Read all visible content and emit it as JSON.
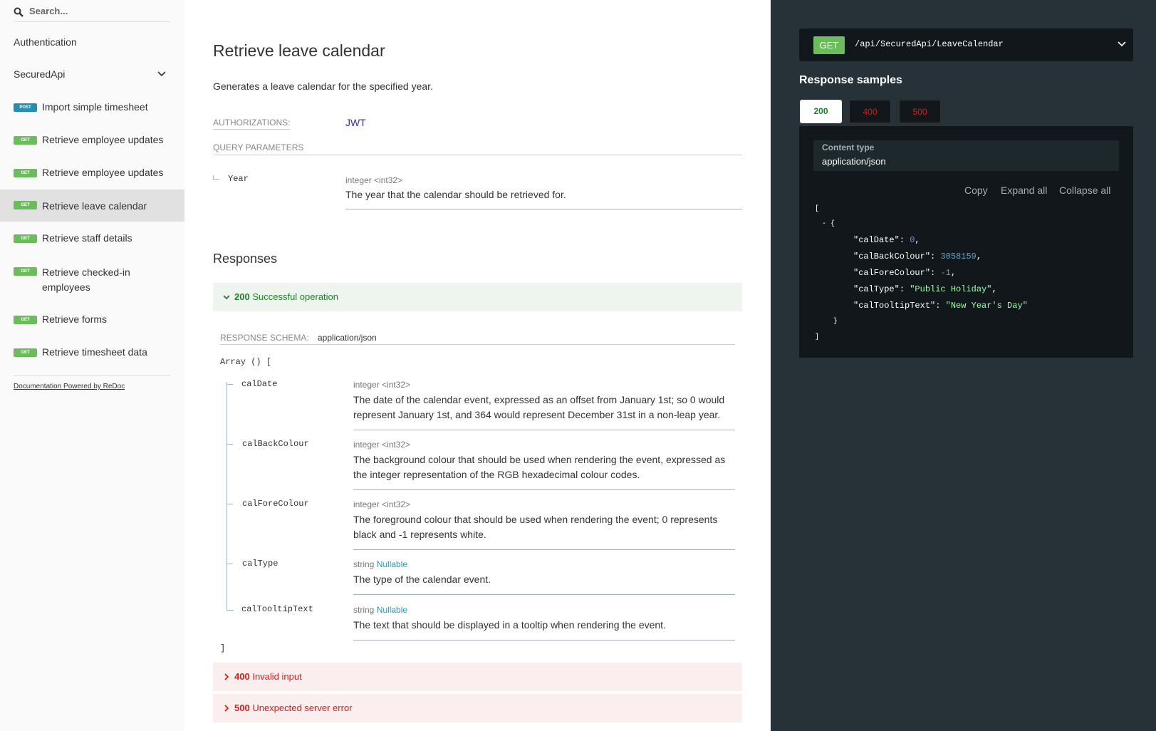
{
  "sidebar": {
    "search_placeholder": "Search...",
    "items": [
      {
        "label": "Authentication"
      },
      {
        "label": "SecuredApi"
      },
      {
        "method": "POST",
        "label": "Import simple timesheet"
      },
      {
        "method": "GET",
        "label": "Retrieve employee updates"
      },
      {
        "method": "GET",
        "label": "Retrieve employee updates"
      },
      {
        "method": "GET",
        "label": "Retrieve leave calendar"
      },
      {
        "method": "GET",
        "label": "Retrieve staff details"
      },
      {
        "method": "GET",
        "label": "Retrieve checked-in",
        "label2": "employees"
      },
      {
        "method": "GET",
        "label": "Retrieve forms"
      },
      {
        "method": "GET",
        "label": "Retrieve timesheet data"
      }
    ],
    "powered_by": "Documentation Powered by ReDoc"
  },
  "main": {
    "title": "Retrieve leave calendar",
    "description": "Generates a leave calendar for the specified year.",
    "authorizations_label": "AUTHORIZATIONS:",
    "authorizations_value": "JWT",
    "query_parameters_label": "QUERY PARAMETERS",
    "query_param": {
      "name": "Year",
      "type": "integer <int32>",
      "description": "The year that the calendar should be retrieved for."
    },
    "responses_title": "Responses",
    "responses": [
      {
        "code": "200",
        "text": "Successful operation"
      },
      {
        "code": "400",
        "text": "Invalid input"
      },
      {
        "code": "500",
        "text": "Unexpected server error"
      }
    ],
    "schema_label": "RESPONSE SCHEMA:",
    "schema_value": "application/json",
    "array_open": "Array () [",
    "array_close": "]",
    "fields": [
      {
        "name": "calDate",
        "type": "integer <int32>",
        "nullable": "",
        "desc1": "The date of the calendar event, expressed as an offset from January 1st; so 0 would",
        "desc2": "represent January 1st, and 364 would represent December 31st in a non-leap year."
      },
      {
        "name": "calBackColour",
        "type": "integer <int32>",
        "nullable": "",
        "desc1": "The background colour that should be used when rendering the event, expressed as",
        "desc2": "the integer representation of the RGB hexadecimal colour codes."
      },
      {
        "name": "calForeColour",
        "type": "integer <int32>",
        "nullable": "",
        "desc1": "The foreground colour that should be used when rendering the event; 0 represents",
        "desc2": "black and -1 represents white."
      },
      {
        "name": "calType",
        "type": "string",
        "nullable": "Nullable",
        "desc1": "The type of the calendar event.",
        "desc2": ""
      },
      {
        "name": "calTooltipText",
        "type": "string",
        "nullable": "Nullable",
        "desc1": "The text that should be displayed in a tooltip when rendering the event.",
        "desc2": ""
      }
    ]
  },
  "right": {
    "method": "GET",
    "path": "/api/SecuredApi/LeaveCalendar",
    "samples_title": "Response samples",
    "tabs": [
      "200",
      "400",
      "500"
    ],
    "content_type_label": "Content type",
    "content_type_value": "application/json",
    "tools": {
      "copy": "Copy",
      "expand": "Expand all",
      "collapse": "Collapse all"
    },
    "json": {
      "open_bracket": "[",
      "collapse_marker": "- {",
      "entries": [
        {
          "key": "\"calDate\"",
          "sep": ": ",
          "value": "0",
          "kind": "num",
          "tail": ","
        },
        {
          "key": "\"calBackColour\"",
          "sep": ": ",
          "value": "3058159",
          "kind": "num",
          "tail": ","
        },
        {
          "key": "\"calForeColour\"",
          "sep": ": ",
          "value": "-1",
          "kind": "num",
          "tail": ","
        },
        {
          "key": "\"calType\"",
          "sep": ": ",
          "value": "\"Public Holiday\"",
          "kind": "str",
          "tail": ","
        },
        {
          "key": "\"calTooltipText\"",
          "sep": ": ",
          "value": "\"New Year's Day\"",
          "kind": "str",
          "tail": ""
        }
      ],
      "close_brace": "}",
      "close_bracket": "]"
    }
  },
  "colors": {
    "get": "#6bbd5b",
    "post": "#248fb2",
    "success": "#1d8127",
    "error": "#d41f1c",
    "right_panel": "#263238"
  }
}
